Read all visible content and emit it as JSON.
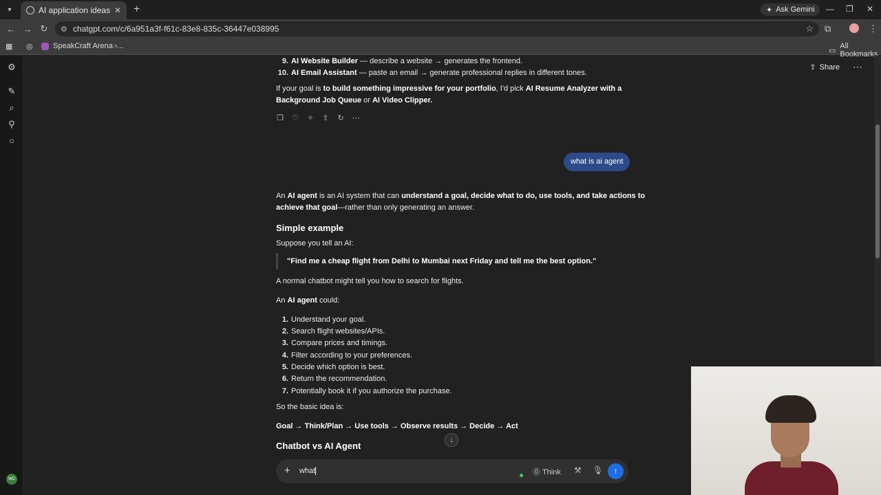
{
  "browser": {
    "tab_title": "AI application ideas",
    "url": "chatgpt.com/c/6a951a3f-f61c-83e8-835c-36447e038995",
    "ask_gemini": "Ask Gemini",
    "bookmarks": [
      {
        "label": "SpeakCraft Arena -..."
      }
    ],
    "all_bookmarks": "All Bookmarks"
  },
  "header": {
    "share_label": "Share"
  },
  "conversation": {
    "prev_list": [
      {
        "num": "9.",
        "bold": "AI Website Builder",
        "rest": " — describe a website → generates the frontend."
      },
      {
        "num": "10.",
        "bold": "AI Email Assistant",
        "rest": " — paste an email → generate professional replies in different tones."
      }
    ],
    "goal_line1_a": "If your goal is ",
    "goal_line1_b": "to build something impressive for your portfolio",
    "goal_line1_c": ", I'd pick ",
    "goal_line1_d": "AI Resume Analyzer with a",
    "goal_line2_a": "Background Job Queue",
    "goal_line2_b": " or ",
    "goal_line2_c": "AI Video Clipper.",
    "user_message": "what is ai agent",
    "intro_a": "An ",
    "intro_b": "AI agent",
    "intro_c": " is an AI system that can ",
    "intro_d": "understand a goal, decide what to do, use tools, and take actions to",
    "intro2_a": "achieve that goal",
    "intro2_b": "—rather than only generating an answer.",
    "section1": "Simple example",
    "suppose": "Suppose you tell an AI:",
    "quote": "\"Find me a cheap flight from Delhi to Mumbai next Friday and tell me the best option.\"",
    "normal": "A normal chatbot might tell you how to search for flights.",
    "could_a": "An ",
    "could_b": "AI agent",
    "could_c": " could:",
    "steps": [
      {
        "num": "1.",
        "text": "Understand your goal."
      },
      {
        "num": "2.",
        "text": "Search flight websites/APIs."
      },
      {
        "num": "3.",
        "text": "Compare prices and timings."
      },
      {
        "num": "4.",
        "text": "Filter according to your preferences."
      },
      {
        "num": "5.",
        "text": "Decide which option is best."
      },
      {
        "num": "6.",
        "text": "Return the recommendation."
      },
      {
        "num": "7.",
        "text": "Potentially book it if you authorize the purchase."
      }
    ],
    "basic_idea": "So the basic idea is:",
    "flow": "Goal → Think/Plan → Use tools → Observe results → Decide → Act",
    "section2": "Chatbot vs AI Agent"
  },
  "composer": {
    "value": "what",
    "think_label": "Think"
  },
  "sidebar": {
    "avatar_text": "WD"
  }
}
